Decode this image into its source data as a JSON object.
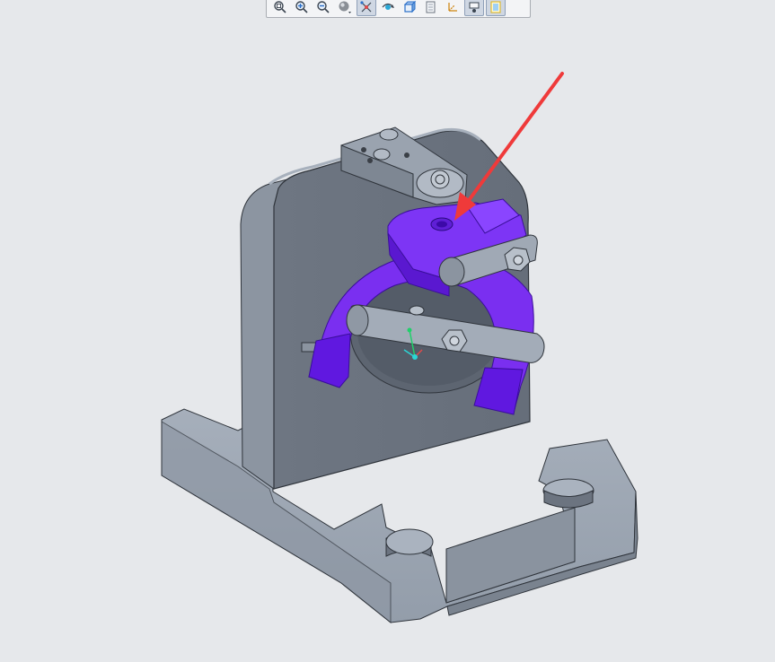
{
  "window": {
    "background": "#e6e8eb"
  },
  "toolbar": {
    "buttons": [
      {
        "icon": "zoom-fit-icon",
        "active": false
      },
      {
        "icon": "zoom-in-icon",
        "active": false
      },
      {
        "icon": "zoom-out-icon",
        "active": false
      },
      {
        "icon": "shading-icon",
        "active": false
      },
      {
        "icon": "datum-display-icon",
        "active": true
      },
      {
        "icon": "spin-center-icon",
        "active": false
      },
      {
        "icon": "view-orient-icon",
        "active": false
      },
      {
        "icon": "saved-views-icon",
        "active": false
      },
      {
        "icon": "csys-display-icon",
        "active": false
      },
      {
        "icon": "annotation-display-icon",
        "active": true
      },
      {
        "icon": "appearance-icon",
        "active": true
      }
    ]
  },
  "model": {
    "fixture_color": "#98a2af",
    "fixture_dark": "#6c7480",
    "fork_color": "#7a2ff0",
    "fork_dark": "#5615c8",
    "arrow_color": "#ef3a3a"
  }
}
